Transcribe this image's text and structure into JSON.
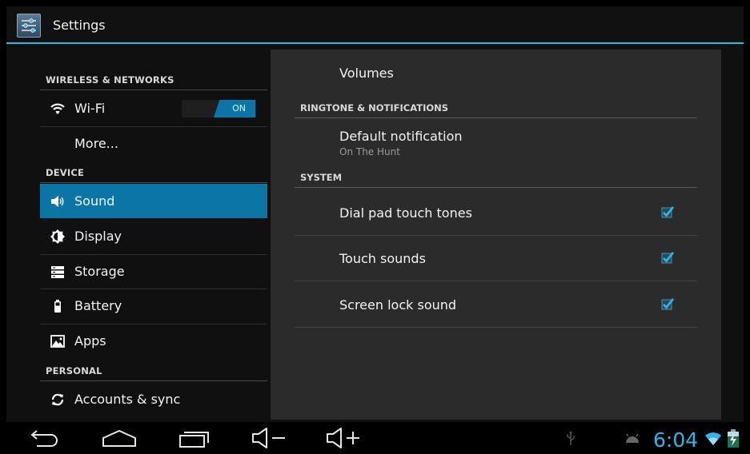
{
  "app": {
    "title": "Settings",
    "icon": "settings-icon"
  },
  "sidebar": {
    "sections": [
      {
        "header": "WIRELESS & NETWORKS"
      },
      {
        "header": "DEVICE"
      },
      {
        "header": "PERSONAL"
      }
    ],
    "wifi": {
      "label": "Wi-Fi",
      "toggle": "ON",
      "icon": "wifi-icon"
    },
    "more": {
      "label": "More..."
    },
    "items": [
      {
        "label": "Sound",
        "icon": "speaker-icon",
        "selected": true
      },
      {
        "label": "Display",
        "icon": "brightness-icon"
      },
      {
        "label": "Storage",
        "icon": "storage-icon"
      },
      {
        "label": "Battery",
        "icon": "battery-icon"
      },
      {
        "label": "Apps",
        "icon": "apps-icon"
      },
      {
        "label": "Accounts & sync",
        "icon": "sync-icon"
      }
    ]
  },
  "sound": {
    "volumes": "Volumes",
    "ringtone_header": "RINGTONE & NOTIFICATIONS",
    "default_notification": {
      "title": "Default notification",
      "value": "On The Hunt"
    },
    "system_header": "SYSTEM",
    "options": [
      {
        "label": "Dial pad touch tones",
        "checked": true
      },
      {
        "label": "Touch sounds",
        "checked": true
      },
      {
        "label": "Screen lock sound",
        "checked": true
      }
    ]
  },
  "statusbar": {
    "time": "6:04"
  },
  "colors": {
    "accent": "#33b5e5",
    "selected": "#0b76a5"
  }
}
